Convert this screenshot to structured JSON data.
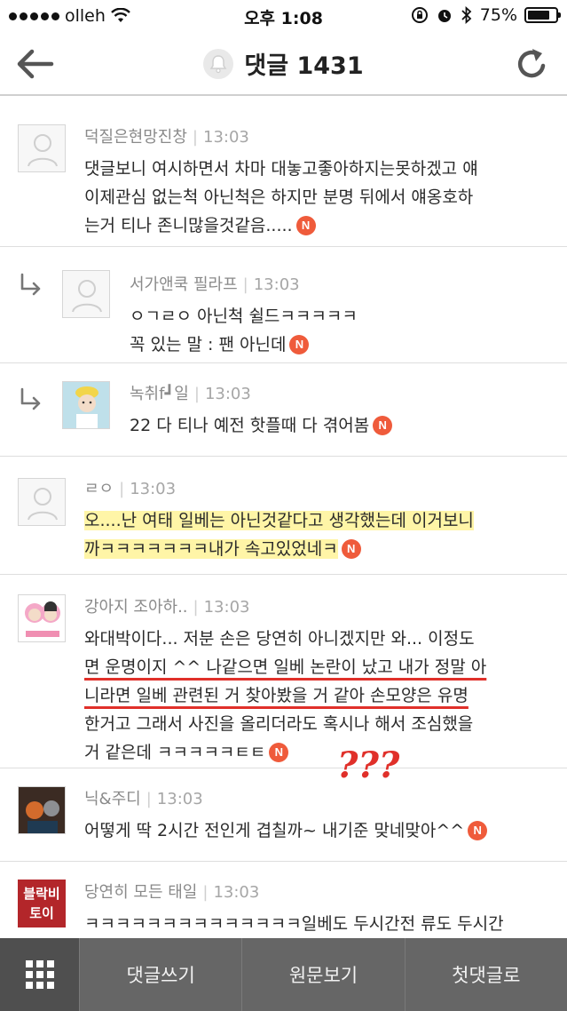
{
  "status_bar": {
    "carrier": "olleh",
    "time": "오후 1:08",
    "battery": "75%"
  },
  "header": {
    "title": "댓글 1431",
    "icons": [
      "back-arrow-icon",
      "bell-icon",
      "refresh-icon"
    ]
  },
  "comments": [
    {
      "author": "덕질은현망진창",
      "time": "13:03",
      "lines": [
        "댓글보니 여시하면서 차마 대놓고좋아하지는못하겠고 얘",
        "이제관심 없는척 아닌척은 하지만 분명 뒤에서 얘옹호하",
        "는거 티나 존니많을것같음....."
      ],
      "reply": false,
      "avatar": "default"
    },
    {
      "author": "서가앤쿡 필라프",
      "time": "13:03",
      "lines": [
        "ㅇㄱㄹㅇ 아닌척 쉴드ㅋㅋㅋㅋㅋ",
        "꼭 있는 말 : 팬 아닌데"
      ],
      "reply": true,
      "avatar": "default"
    },
    {
      "author": "녹취f┛일",
      "time": "13:03",
      "lines": [
        "22 다 티나 예전 핫플때 다 겪어봄"
      ],
      "reply": true,
      "avatar": "photo"
    },
    {
      "author": "ㄹㅇ",
      "time": "13:03",
      "lines": [
        "오....난 여태 일베는 아닌것같다고 생각했는데 이거보니",
        "까ㅋㅋㅋㅋㅋㅋㅋ내가 속고있었네ㅋ"
      ],
      "reply": false,
      "avatar": "default"
    },
    {
      "author": "강아지 조아하..",
      "time": "13:03",
      "lines": [
        "와대박이다... 저분 손은 당연히 아니겠지만 와... 이정도",
        "면 운명이지 ^^ 나같으면 일베 논란이 났고 내가 정말 아",
        "니라면 일베 관련된 거 찾아봤을 거 같아 손모양은 유명",
        "한거고 그래서 사진을 올리더라도 혹시나 해서 조심했을",
        "거 같은데 ㅋㅋㅋㅋㅋㅌㅌ"
      ],
      "reply": false,
      "avatar": "sticker"
    },
    {
      "author": "닉&주디",
      "time": "13:03",
      "lines": [
        "어떻게 딱 2시간 전인게 겹칠까~ 내기준 맞네맞아^^"
      ],
      "reply": false,
      "avatar": "movie"
    },
    {
      "author": "당연히 모든 태일",
      "time": "13:03",
      "lines": [
        "ㅋㅋㅋㅋㅋㅋㅋㅋㅋㅋㅋㅋㅋㅋ일베도 두시간전 류도 두시간"
      ],
      "reply": false,
      "avatar": "block"
    }
  ],
  "avatar_block_text": [
    "블락비",
    "토이"
  ],
  "badge_label": "N",
  "annotation": "???",
  "bottom_bar": {
    "write": "댓글쓰기",
    "original": "원문보기",
    "first": "첫댓글로"
  },
  "colors": {
    "badge": "#ef5b3b",
    "bottom_bar": "#666666",
    "highlight_yellow": "#fff078",
    "underline_red": "#e0302a"
  }
}
